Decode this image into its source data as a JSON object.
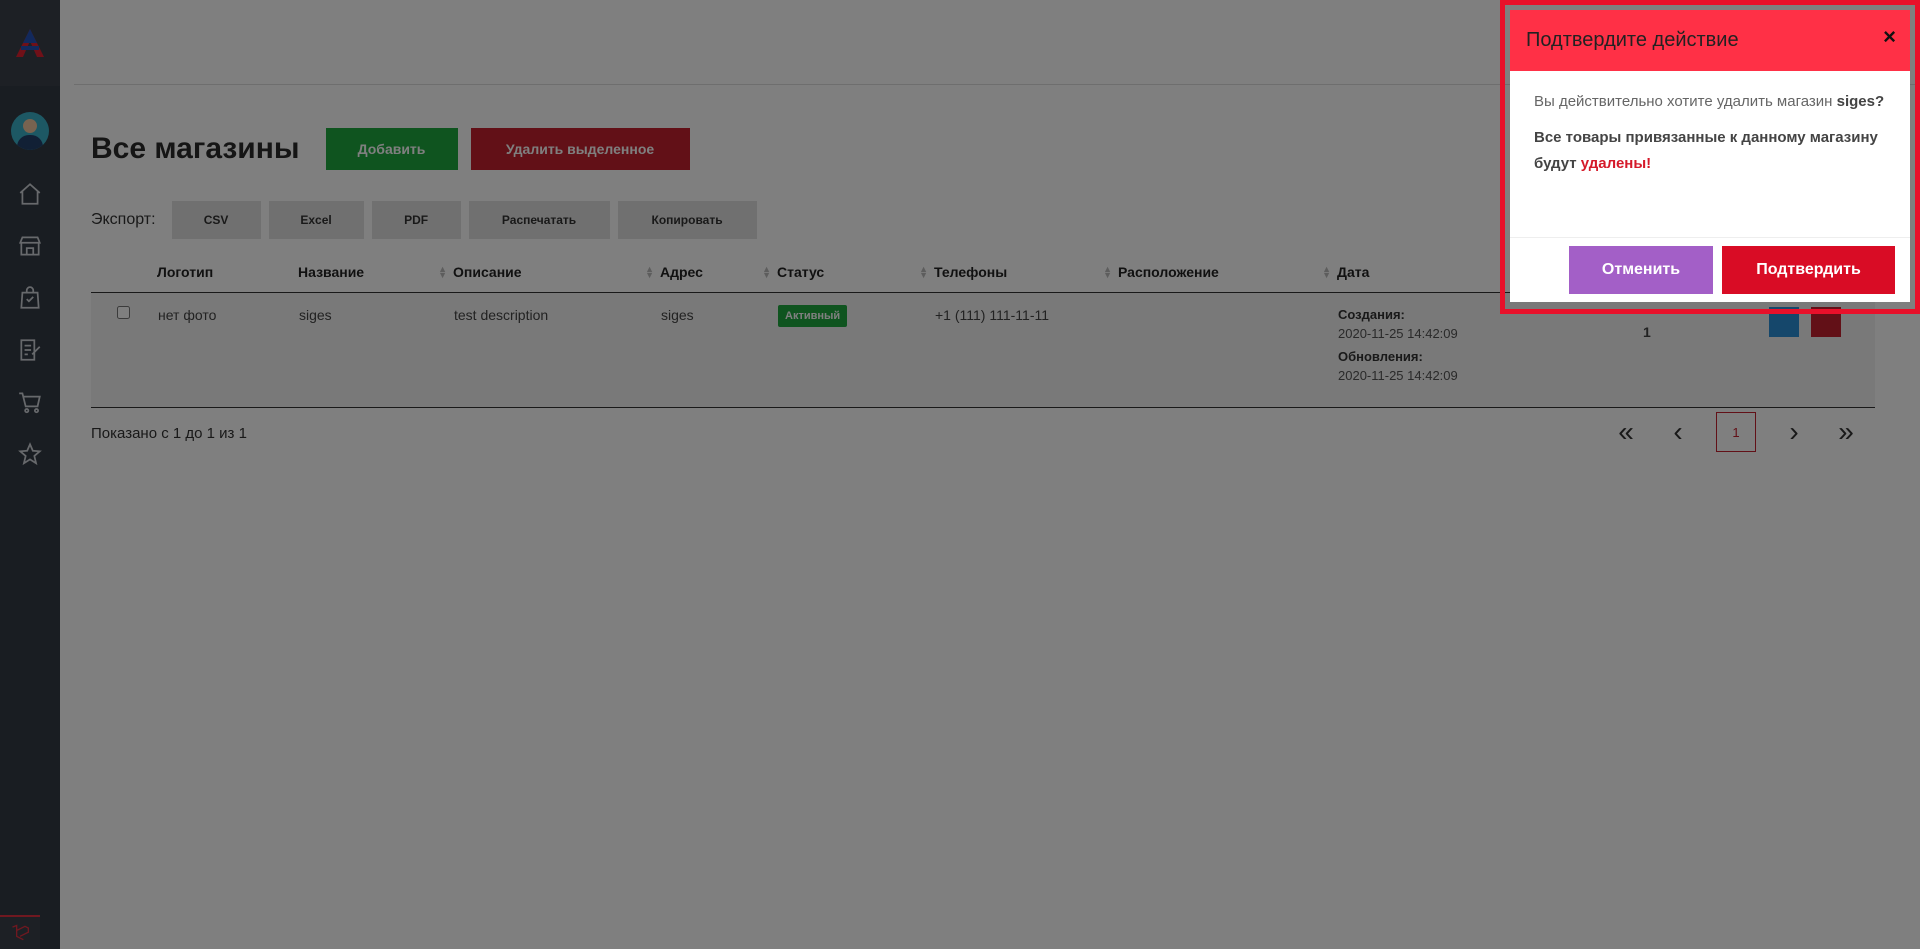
{
  "header": {
    "page_title": "Все магазины",
    "add_label": "Добавить",
    "delete_selected_label": "Удалить выделенное"
  },
  "export": {
    "label": "Экспорт:",
    "buttons": [
      "CSV",
      "Excel",
      "PDF",
      "Распечатать",
      "Копировать"
    ]
  },
  "table": {
    "columns": [
      "Логотип",
      "Название",
      "Описание",
      "Адрес",
      "Статус",
      "Телефоны",
      "Расположение",
      "Дата"
    ],
    "rows": [
      {
        "logo": "нет фото",
        "name": "siges",
        "description": "test description",
        "address": "siges",
        "status": "Активный",
        "phones": "+1 (111) 111-11-11",
        "created_label": "Создания:",
        "created": "2020-11-25 14:42:09",
        "updated_label": "Обновления:",
        "updated": "2020-11-25 14:42:09",
        "sort": "1"
      }
    ]
  },
  "footer": {
    "info": "Показано с 1 до 1 из 1",
    "current_page": "1"
  },
  "modal": {
    "title": "Подтвердите действие",
    "close": "×",
    "question": "Вы действительно хотите удалить магазин",
    "store_name": "siges?",
    "warning_part1": "Все товары привязанные к данному магазину будут",
    "warning_red": "удалены!",
    "cancel_label": "Отменить",
    "confirm_label": "Подтвердить"
  },
  "colors": {
    "sidebar": "#333a44",
    "add_button": "#1fa83e",
    "delete_button": "#c4202e",
    "modal_header": "#ff3046",
    "cancel_button": "#a35fc7",
    "confirm_button": "#d90c25"
  }
}
